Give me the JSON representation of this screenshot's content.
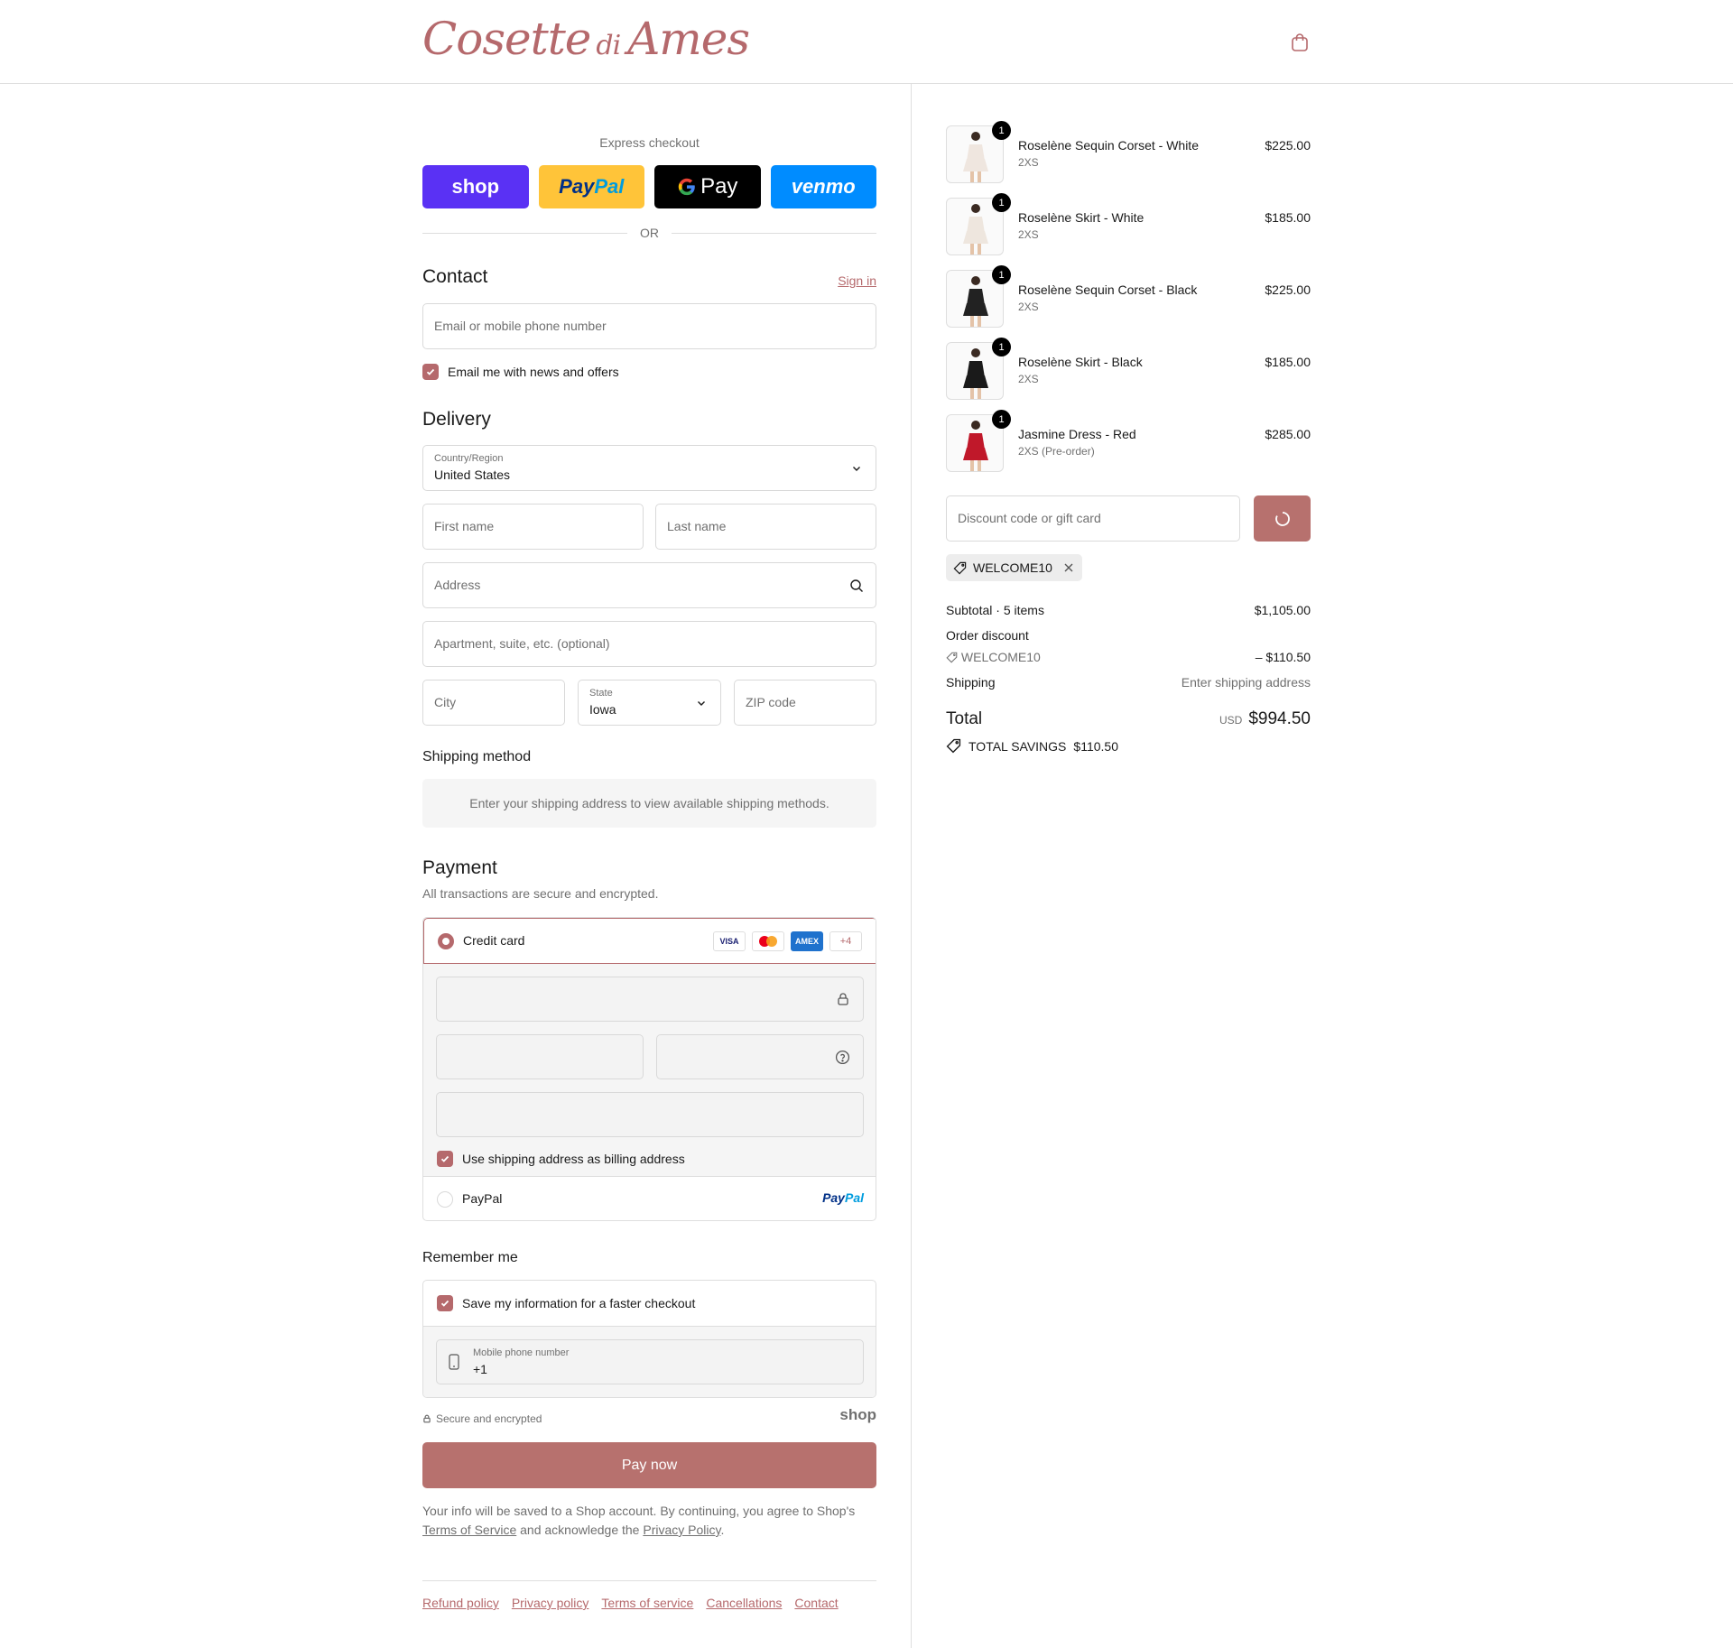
{
  "brand": {
    "name_part1": "Cosette",
    "name_di": "di",
    "name_part2": "Ames"
  },
  "express": {
    "title": "Express checkout",
    "buttons": {
      "shop": "shop",
      "paypal_1": "Pay",
      "paypal_2": "Pal",
      "gpay": "Pay",
      "venmo": "venmo"
    },
    "or": "OR"
  },
  "contact": {
    "title": "Contact",
    "sign_in": "Sign in",
    "email_placeholder": "Email or mobile phone number",
    "news_label": "Email me with news and offers"
  },
  "delivery": {
    "title": "Delivery",
    "country_label": "Country/Region",
    "country_value": "United States",
    "first_name": "First name",
    "last_name": "Last name",
    "address": "Address",
    "apartment": "Apartment, suite, etc. (optional)",
    "city": "City",
    "state_label": "State",
    "state_value": "Iowa",
    "zip": "ZIP code"
  },
  "shipping": {
    "title": "Shipping method",
    "notice": "Enter your shipping address to view available shipping methods."
  },
  "payment": {
    "title": "Payment",
    "subtitle": "All transactions are secure and encrypted.",
    "credit_card": "Credit card",
    "cards": {
      "visa": "VISA",
      "amex": "AMEX",
      "more": "+4"
    },
    "billing_label": "Use shipping address as billing address",
    "paypal": "PayPal",
    "paypal_logo_1": "Pay",
    "paypal_logo_2": "Pal"
  },
  "remember": {
    "title": "Remember me",
    "save_label": "Save my information for a faster checkout",
    "phone_label": "Mobile phone number",
    "phone_value": "+1"
  },
  "secure": {
    "text": "Secure and encrypted",
    "shop": "shop"
  },
  "pay_now": "Pay now",
  "legal": {
    "line1": "Your info will be saved to a Shop account. By continuing, you agree to Shop's",
    "terms": "Terms of Service",
    "middle": " and acknowledge the ",
    "privacy": "Privacy Policy",
    "end": "."
  },
  "footer": {
    "links": [
      "Refund policy",
      "Privacy policy",
      "Terms of service",
      "Cancellations",
      "Contact"
    ]
  },
  "items": [
    {
      "name": "Roselène Sequin Corset - White",
      "variant": "2XS",
      "price": "$225.00",
      "qty": "1",
      "color": "#efe6df"
    },
    {
      "name": "Roselène Skirt - White",
      "variant": "2XS",
      "price": "$185.00",
      "qty": "1",
      "color": "#eee6de"
    },
    {
      "name": "Roselène Sequin Corset - Black",
      "variant": "2XS",
      "price": "$225.00",
      "qty": "1",
      "color": "#222222"
    },
    {
      "name": "Roselène Skirt - Black",
      "variant": "2XS",
      "price": "$185.00",
      "qty": "1",
      "color": "#1a1a1a"
    },
    {
      "name": "Jasmine Dress - Red",
      "variant": "2XS (Pre-order)",
      "price": "$285.00",
      "qty": "1",
      "color": "#c0182a"
    }
  ],
  "discount": {
    "placeholder": "Discount code or gift card",
    "applied_code": "WELCOME10"
  },
  "summary": {
    "subtotal_label": "Subtotal · 5 items",
    "subtotal_value": "$1,105.00",
    "order_discount_label": "Order discount",
    "discount_code": "WELCOME10",
    "discount_value": "– $110.50",
    "shipping_label": "Shipping",
    "shipping_value": "Enter shipping address",
    "total_label": "Total",
    "currency": "USD",
    "total_value": "$994.50",
    "savings_label": "TOTAL SAVINGS",
    "savings_value": "$110.50"
  },
  "colors": {
    "accent": "#b5696c",
    "shop_purple": "#5a31f4",
    "paypal_yellow": "#ffc439",
    "venmo_blue": "#008cff"
  }
}
